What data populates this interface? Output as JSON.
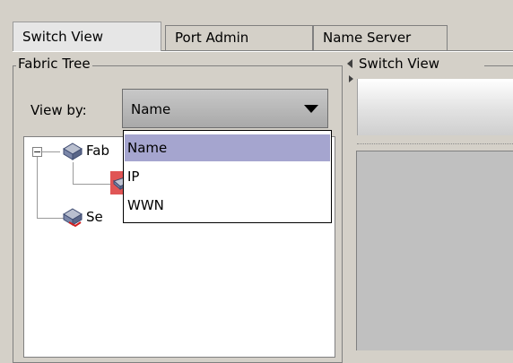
{
  "tabs": [
    {
      "label": "Switch View",
      "active": true
    },
    {
      "label": "Port Admin",
      "active": false
    },
    {
      "label": "Name Server",
      "active": false
    }
  ],
  "fabric_tree": {
    "title": "Fabric Tree",
    "view_by_label": "View by:",
    "view_by_value": "Name",
    "view_by_options": [
      "Name",
      "IP",
      "WWN"
    ],
    "selected_option": "Name",
    "nodes": [
      {
        "label": "Fab",
        "icon": "fabric-icon",
        "expanded": true
      },
      {
        "label": "",
        "icon": "switch-icon",
        "selected": true
      },
      {
        "label": "Se",
        "icon": "server-icon"
      }
    ]
  },
  "switch_view": {
    "title": "Switch View"
  },
  "colors": {
    "background": "#d4d0c8",
    "dropdown_selection": "#a5a5cf",
    "tree_selection": "#e05555"
  }
}
